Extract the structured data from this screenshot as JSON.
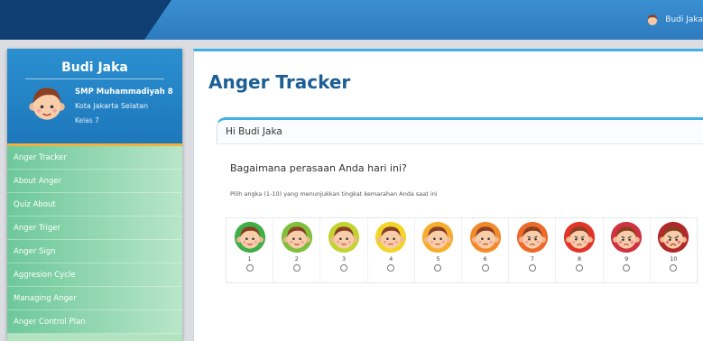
{
  "topbar": {
    "username": "Budi Jaka"
  },
  "profile": {
    "name": "Budi Jaka",
    "school": "SMP Muhammadiyah 8",
    "city": "Kota Jakarta Selatan",
    "grade": "Kelas 7"
  },
  "menu": {
    "items": [
      {
        "label": "Anger Tracker"
      },
      {
        "label": "About Anger"
      },
      {
        "label": "Quiz About"
      },
      {
        "label": "Anger Triger"
      },
      {
        "label": "Anger Sign"
      },
      {
        "label": "Aggresion Cycle"
      },
      {
        "label": "Managing Anger"
      },
      {
        "label": "Anger Control Plan"
      }
    ]
  },
  "main": {
    "title": "Anger Tracker",
    "greeting": "Hi Budi Jaka",
    "question": "Bagaimana perasaan Anda hari ini?",
    "hint": "Pilih angka (1-10) yang menunjukkan tingkat kemarahan Anda saat ini"
  },
  "scale": {
    "options": [
      {
        "number": "1",
        "ring": "#3fae48"
      },
      {
        "number": "2",
        "ring": "#7fbf3c"
      },
      {
        "number": "3",
        "ring": "#c2d432"
      },
      {
        "number": "4",
        "ring": "#f2d52a"
      },
      {
        "number": "5",
        "ring": "#f6ad2e"
      },
      {
        "number": "6",
        "ring": "#f28a2c"
      },
      {
        "number": "7",
        "ring": "#ec6a2a"
      },
      {
        "number": "8",
        "ring": "#e2352a"
      },
      {
        "number": "9",
        "ring": "#cf3340"
      },
      {
        "number": "10",
        "ring": "#b02a2a"
      }
    ]
  }
}
